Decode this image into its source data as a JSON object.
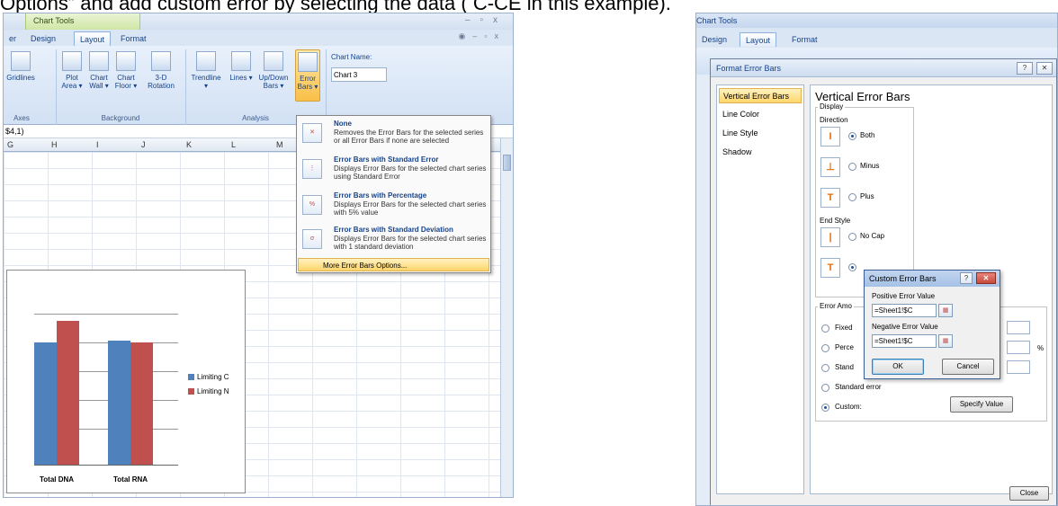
{
  "caption": "Options” and add custom error by selecting the data ( C-CE in this example).",
  "left": {
    "context_tab": "Chart Tools",
    "tabs": [
      "er",
      "Design",
      "Layout",
      "Format"
    ],
    "active_tab": "Layout",
    "ribbon_buttons": [
      {
        "label": "Gridlines"
      },
      {
        "label": "Plot Area ▾"
      },
      {
        "label": "Chart Wall ▾"
      },
      {
        "label": "Chart Floor ▾"
      },
      {
        "label": "3-D Rotation"
      },
      {
        "label": "Trendline ▾"
      },
      {
        "label": "Lines ▾"
      },
      {
        "label": "Up/Down Bars ▾"
      },
      {
        "label": "Error Bars ▾"
      }
    ],
    "group_labels": [
      "Axes",
      "Background",
      "Analysis"
    ],
    "chart_name_label": "Chart Name:",
    "chart_name_value": "Chart 3",
    "formula": "$4,1)",
    "columns": [
      "G",
      "H",
      "I",
      "J",
      "K",
      "L",
      "M"
    ],
    "chart": {
      "categories": [
        "Total DNA",
        "Total RNA"
      ],
      "series": [
        {
          "name": "Limiting C",
          "color": "#4f81bd",
          "values": [
            0.85,
            0.86
          ]
        },
        {
          "name": "Limiting N",
          "color": "#c0504d",
          "values": [
            1.0,
            0.85
          ]
        }
      ]
    },
    "dropdown": {
      "items": [
        {
          "title": "None",
          "desc": "Removes the Error Bars for the selected series or all Error Bars if none are selected"
        },
        {
          "title": "Error Bars with Standard Error",
          "desc": "Displays Error Bars for the selected chart series using Standard Error"
        },
        {
          "title": "Error Bars with Percentage",
          "desc": "Displays Error Bars for the selected chart series with 5% value"
        },
        {
          "title": "Error Bars with Standard Deviation",
          "desc": "Displays Error Bars for the selected chart series with 1 standard deviation"
        }
      ],
      "more": "More Error Bars Options..."
    }
  },
  "right": {
    "context_tab": "Chart Tools",
    "tabs": [
      "Design",
      "Layout",
      "Format"
    ],
    "format_dialog": {
      "title": "Format Error Bars",
      "nav": [
        "Vertical Error Bars",
        "Line Color",
        "Line Style",
        "Shadow"
      ],
      "heading": "Vertical Error Bars",
      "display_label": "Display",
      "direction_label": "Direction",
      "direction_options": [
        "Both",
        "Minus",
        "Plus"
      ],
      "end_style_label": "End Style",
      "end_style_options": [
        "No Cap"
      ],
      "error_amount_label": "Error Amo",
      "amount_options": [
        "Fixed",
        "Perce",
        "Stand",
        "Standard error",
        "Custom:"
      ],
      "pct_symbol": "%",
      "specify_value": "Specify Value",
      "close": "Close"
    },
    "custom_dialog": {
      "title": "Custom Error Bars",
      "positive_label": "Positive Error Value",
      "positive_value": "=Sheet1!$C",
      "negative_label": "Negative Error Value",
      "negative_value": "=Sheet1!$C",
      "ok": "OK",
      "cancel": "Cancel"
    }
  }
}
